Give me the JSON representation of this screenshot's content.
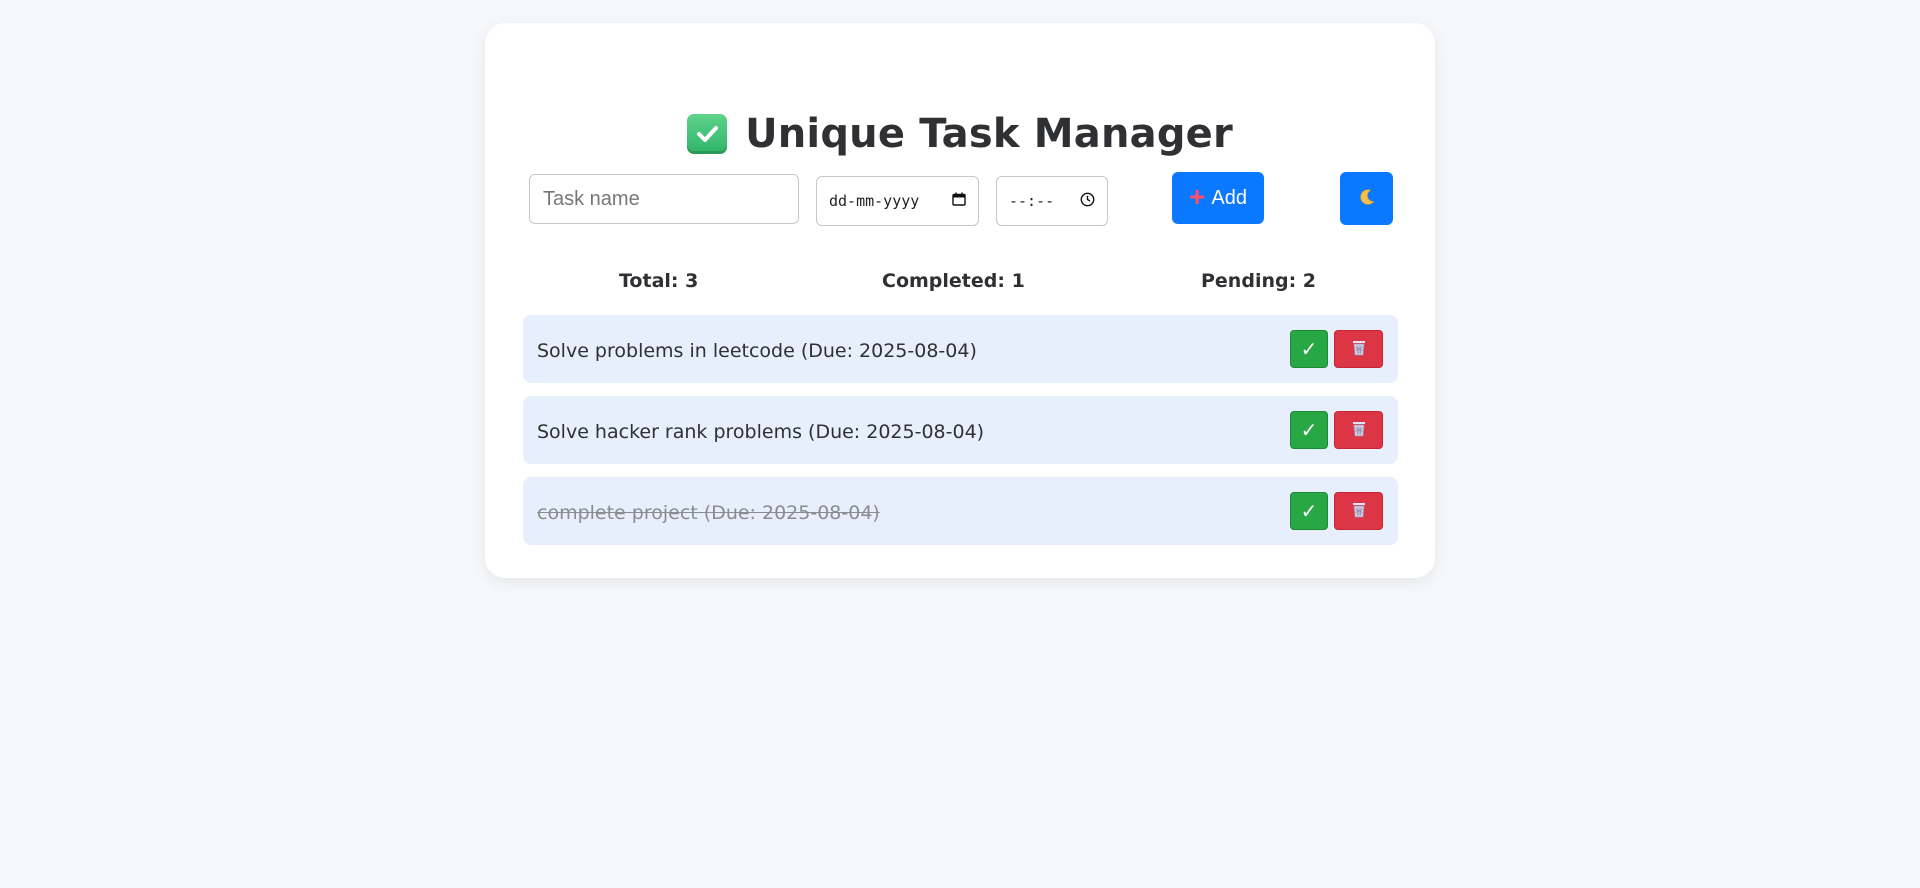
{
  "app": {
    "title": "Unique Task Manager",
    "title_icon": "check-box-icon"
  },
  "form": {
    "task_placeholder": "Task name",
    "date_placeholder": "dd-mm-yyyy",
    "time_placeholder": "--:--",
    "add_label": "Add",
    "add_icon": "plus-icon",
    "theme_icon": "moon-icon"
  },
  "stats": {
    "total": "Total: 3",
    "completed": "Completed: 1",
    "pending": "Pending: 2"
  },
  "tasks": [
    {
      "text": "Solve problems in leetcode (Due: 2025-08-04)",
      "completed": false
    },
    {
      "text": "Solve hacker rank problems (Due: 2025-08-04)",
      "completed": false
    },
    {
      "text": "complete project (Due: 2025-08-04)",
      "completed": true
    }
  ],
  "buttons": {
    "complete_glyph": "✓",
    "complete_icon": "check-icon",
    "delete_icon": "trash-icon"
  },
  "colors": {
    "primary": "#0a78ff",
    "complete": "#28a745",
    "delete": "#dc3545",
    "task_bg": "#e7effd",
    "page_bg": "#f6f8fc"
  }
}
